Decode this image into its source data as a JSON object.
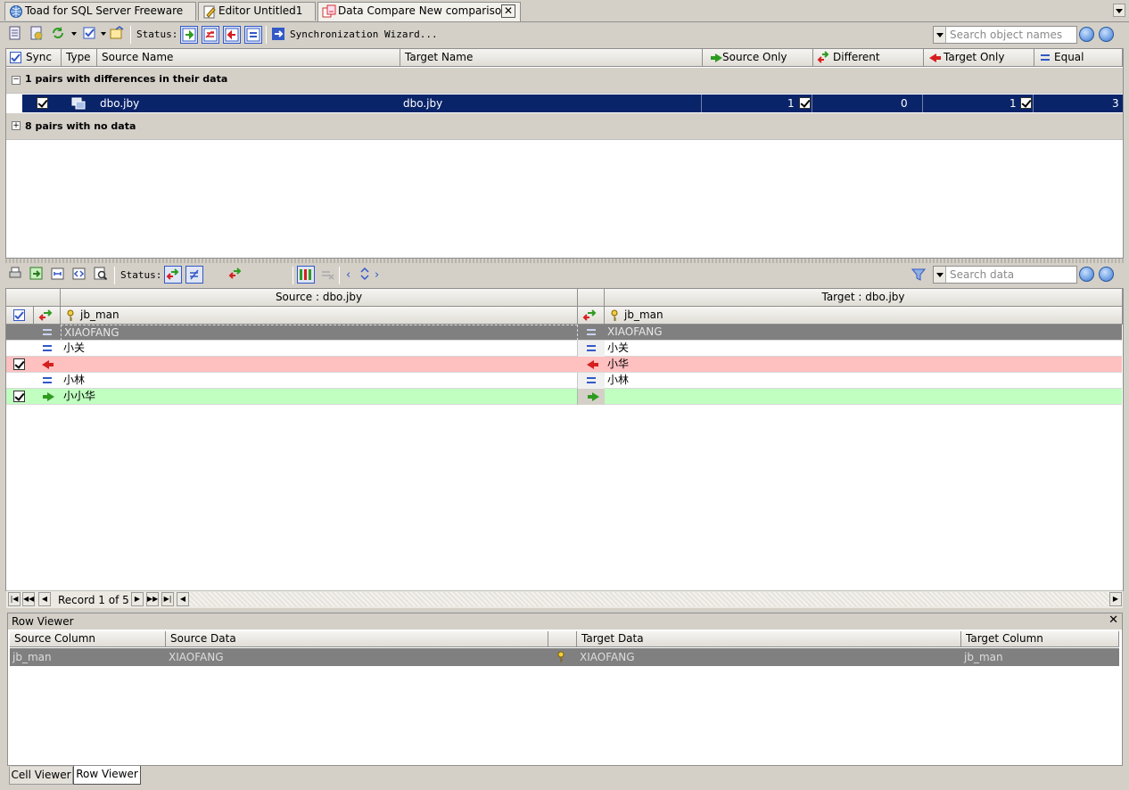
{
  "tabs": [
    {
      "label": "Toad for SQL Server Freeware",
      "icon": "globe-icon"
    },
    {
      "label": "Editor Untitled1",
      "icon": "editor-icon"
    },
    {
      "label": "Data Compare New comparison*",
      "icon": "data-compare-icon"
    }
  ],
  "toolbar": {
    "status_label": "Status:",
    "sync_wizard_label": "Synchronization Wizard...",
    "search_placeholder": "Search object names"
  },
  "top_grid": {
    "headers": {
      "sync": "Sync",
      "type": "Type",
      "source_name": "Source Name",
      "target_name": "Target Name",
      "source_only": "Source Only",
      "different": "Different",
      "target_only": "Target Only",
      "equal": "Equal"
    },
    "group1": "1 pairs with differences in their data",
    "row": {
      "source": "dbo.jby",
      "target": "dbo.jby",
      "source_only": "1",
      "different": "0",
      "target_only": "1",
      "equal": "3"
    },
    "group2": "8 pairs with no data"
  },
  "data_toolbar": {
    "status_label": "Status:",
    "search_placeholder": "Search data"
  },
  "data_grid": {
    "source_header": "Source : dbo.jby",
    "target_header": "Target : dbo.jby",
    "source_col": "jb_man",
    "target_col": "jb_man",
    "rows": [
      {
        "status": "equal",
        "sync": false,
        "source": "XIAOFANG",
        "target": "XIAOFANG"
      },
      {
        "status": "equal",
        "sync": false,
        "source": "小关",
        "target": "小关"
      },
      {
        "status": "target-only",
        "sync": true,
        "source": "",
        "target": "小华"
      },
      {
        "status": "equal",
        "sync": false,
        "source": "小林",
        "target": "小林"
      },
      {
        "status": "source-only",
        "sync": true,
        "source": "小小华",
        "target": ""
      }
    ],
    "record_label": "Record 1 of 5"
  },
  "row_viewer": {
    "title": "Row Viewer",
    "headers": {
      "source_column": "Source Column",
      "source_data": "Source Data",
      "target_data": "Target Data",
      "target_column": "Target Column"
    },
    "row": {
      "source_column": "jb_man",
      "source_data": "XIAOFANG",
      "target_data": "XIAOFANG",
      "target_column": "jb_man"
    }
  },
  "bottom_tabs": [
    "Cell Viewer",
    "Row Viewer"
  ],
  "colors": {
    "selection": "#0a246a",
    "target_only_row": "#ffc0c0",
    "source_only_row": "#c0ffc0",
    "highlight_row": "#808080"
  }
}
